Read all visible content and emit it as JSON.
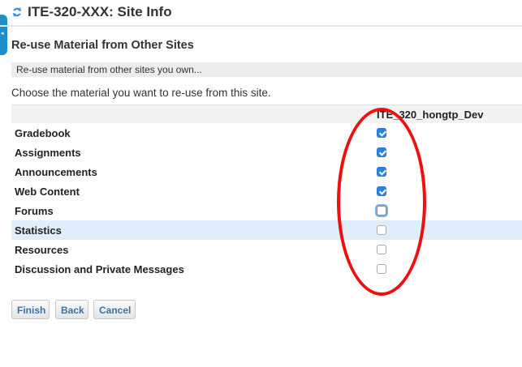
{
  "header": {
    "icon": "refresh-icon",
    "title": "ITE-320-XXX: Site Info"
  },
  "sidebar_toggle": {
    "icon": "collapse-left-icon",
    "glyph": "◂"
  },
  "section_title": "Re-use Material from Other Sites",
  "info_bar": "Re-use material from other sites you own...",
  "instructions": "Choose the material you want to re-use from this site.",
  "table": {
    "site_column": "ITE_320_hongtp_Dev",
    "rows": [
      {
        "label": "Gradebook",
        "checked": true
      },
      {
        "label": "Assignments",
        "checked": true
      },
      {
        "label": "Announcements",
        "checked": true
      },
      {
        "label": "Web Content",
        "checked": true
      },
      {
        "label": "Forums",
        "checked": false
      },
      {
        "label": "Statistics",
        "checked": false
      },
      {
        "label": "Resources",
        "checked": false
      },
      {
        "label": "Discussion and Private Messages",
        "checked": false
      }
    ]
  },
  "buttons": {
    "finish": "Finish",
    "back": "Back",
    "cancel": "Cancel"
  },
  "colors": {
    "accent": "#1d8ec7",
    "checkbox_checked": "#2e82e6",
    "highlight_row": "#dfeefa",
    "annotation": "#ec1010"
  }
}
